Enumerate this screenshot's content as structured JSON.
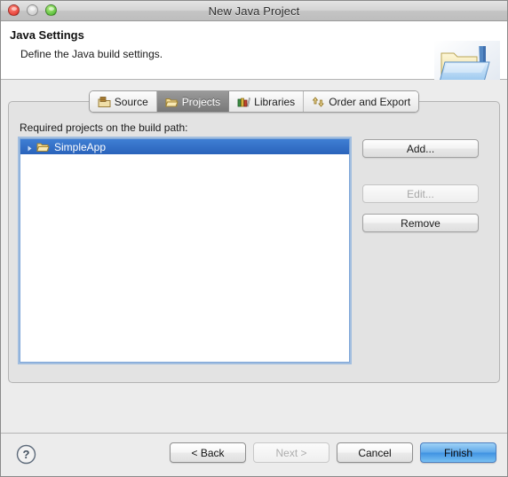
{
  "window": {
    "title": "New Java Project",
    "traffic_lights": [
      {
        "name": "close",
        "color": "#e8453c"
      },
      {
        "name": "minimize",
        "color": "#cfcfcf"
      },
      {
        "name": "zoom",
        "color": "#5fc13f"
      }
    ]
  },
  "header": {
    "title": "Java Settings",
    "description": "Define the Java build settings.",
    "icon": "java-project-folder-icon"
  },
  "tabs": [
    {
      "label": "Source",
      "icon": "package-icon",
      "selected": false
    },
    {
      "label": "Projects",
      "icon": "open-folder-icon",
      "selected": true
    },
    {
      "label": "Libraries",
      "icon": "books-icon",
      "selected": false
    },
    {
      "label": "Order and Export",
      "icon": "updown-arrows-icon",
      "selected": false
    }
  ],
  "panel": {
    "field_label": "Required projects on the build path:",
    "list_items": [
      {
        "label": "SimpleApp",
        "icon": "open-folder-icon",
        "selected": true,
        "expandable": true
      }
    ],
    "side_buttons": [
      {
        "label": "Add...",
        "disabled": false
      },
      {
        "label": "Edit...",
        "disabled": true
      },
      {
        "label": "Remove",
        "disabled": false
      }
    ]
  },
  "footer": {
    "help_label": "?",
    "buttons": [
      {
        "label": "< Back",
        "disabled": false,
        "default": false
      },
      {
        "label": "Next >",
        "disabled": true,
        "default": false
      },
      {
        "label": "Cancel",
        "disabled": false,
        "default": false
      },
      {
        "label": "Finish",
        "disabled": false,
        "default": true
      }
    ]
  },
  "colors": {
    "selection_blue": "#2a63bb",
    "default_button_blue": "#3f92e2",
    "panel_bg": "#e3e3e3",
    "window_bg": "#ececec"
  }
}
